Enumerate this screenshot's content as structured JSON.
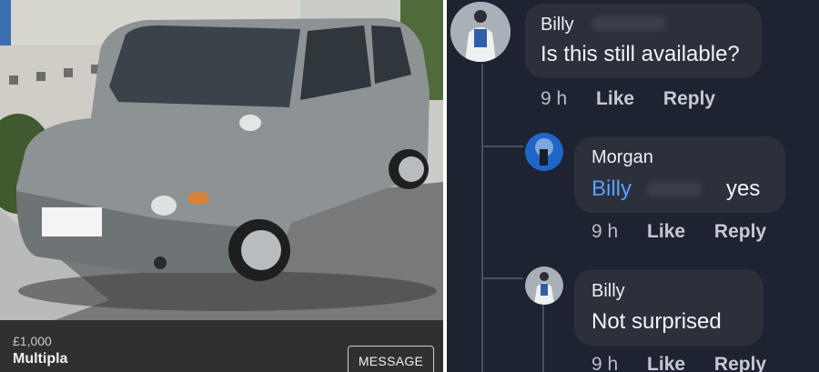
{
  "listing": {
    "price": "£1,000",
    "title": "Multipla",
    "message_button": "MESSAGE"
  },
  "comments": [
    {
      "author": "Billy",
      "text": "Is this still available?",
      "time": "9 h",
      "like": "Like",
      "reply": "Reply"
    },
    {
      "author": "Morgan",
      "mention": "Billy",
      "text": "yes",
      "time": "9 h",
      "like": "Like",
      "reply": "Reply"
    },
    {
      "author": "Billy",
      "text": "Not surprised",
      "time": "9 h",
      "like": "Like",
      "reply": "Reply"
    }
  ],
  "colors": {
    "thread_background": "#1d2330",
    "bubble": "#2b303b",
    "mention": "#5aa0ff",
    "car_body": "#8d9294"
  }
}
